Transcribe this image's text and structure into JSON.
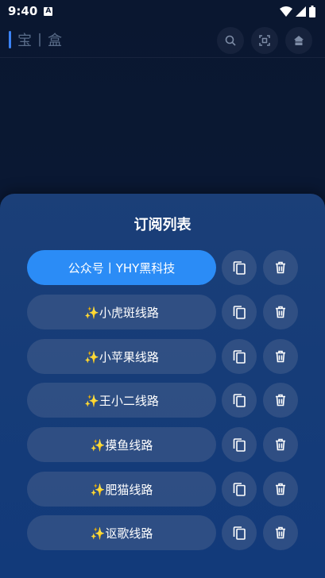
{
  "status_bar": {
    "time": "9:40",
    "notification_badge": "A"
  },
  "header": {
    "title": "宝丨盒"
  },
  "sheet": {
    "title": "订阅列表",
    "items": [
      {
        "label": "公众号丨YHY黑科技",
        "active": true
      },
      {
        "label": "✨小虎斑线路",
        "active": false
      },
      {
        "label": "✨小苹果线路",
        "active": false
      },
      {
        "label": "✨王小二线路",
        "active": false
      },
      {
        "label": "✨摸鱼线路",
        "active": false
      },
      {
        "label": "✨肥猫线路",
        "active": false
      },
      {
        "label": "✨讴歌线路",
        "active": false
      }
    ]
  },
  "colors": {
    "accent": "#2b8cf6",
    "background": "#0a1730",
    "sheet": "#163c78"
  },
  "icons": [
    "search-icon",
    "scan-icon",
    "home-icon",
    "copy-icon",
    "trash-icon",
    "wifi-icon",
    "signal-icon",
    "battery-icon"
  ]
}
